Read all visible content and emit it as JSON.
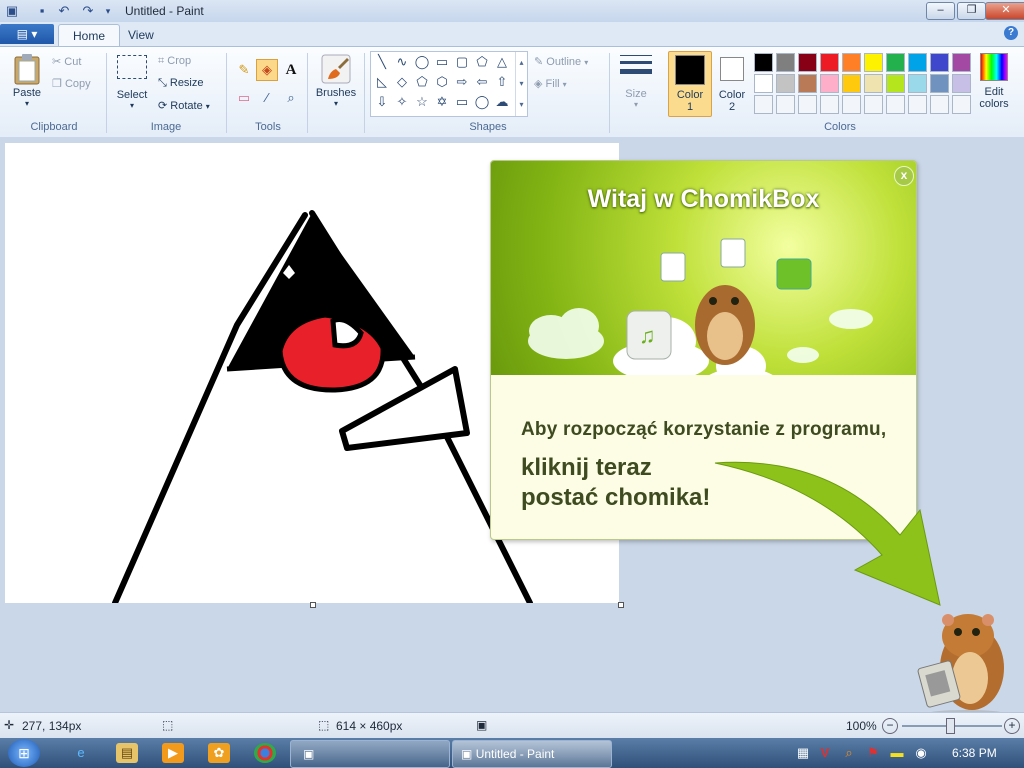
{
  "window": {
    "title": "Untitled - Paint",
    "minimize": "–",
    "maximize": "❐",
    "close": "✕"
  },
  "tabs": {
    "file": "▤ ▾",
    "home": "Home",
    "view": "View",
    "help": "?"
  },
  "ribbon": {
    "clipboard": {
      "label": "Clipboard",
      "paste": "Paste",
      "cut": "Cut",
      "copy": "Copy"
    },
    "image": {
      "label": "Image",
      "select": "Select",
      "crop": "Crop",
      "resize": "Resize",
      "rotate": "Rotate"
    },
    "tools": {
      "label": "Tools"
    },
    "brushes": {
      "label": "Brushes"
    },
    "shapes": {
      "label": "Shapes",
      "outline": "Outline",
      "fill": "Fill"
    },
    "size": {
      "label": "Size"
    },
    "color1": {
      "label": "Color",
      "sub": "1",
      "value": "#000000"
    },
    "color2": {
      "label": "Color",
      "sub": "2",
      "value": "#ffffff"
    },
    "colors": {
      "label": "Colors",
      "edit": "Edit",
      "edit2": "colors",
      "palette": [
        "#000000",
        "#7f7f7f",
        "#880015",
        "#ed1c24",
        "#ff7f27",
        "#fff200",
        "#22b14c",
        "#00a2e8",
        "#3f48cc",
        "#a349a4",
        "#ffffff",
        "#c3c3c3",
        "#b97a57",
        "#ffaec9",
        "#ffc90e",
        "#efe4b0",
        "#b5e61d",
        "#99d9ea",
        "#7092be",
        "#c8bfe7"
      ]
    }
  },
  "popup": {
    "title": "Witaj w ChomikBox",
    "close": "x",
    "line1": "Aby rozpocząć korzystanie z programu,",
    "line2a": "kliknij teraz",
    "line2b": "postać chomika!"
  },
  "status": {
    "cursor": "277, 134px",
    "size": "614 × 460px",
    "zoom": "100%"
  },
  "taskbar": {
    "window_paint": "Untitled - Paint",
    "clock": "6:38 PM"
  }
}
